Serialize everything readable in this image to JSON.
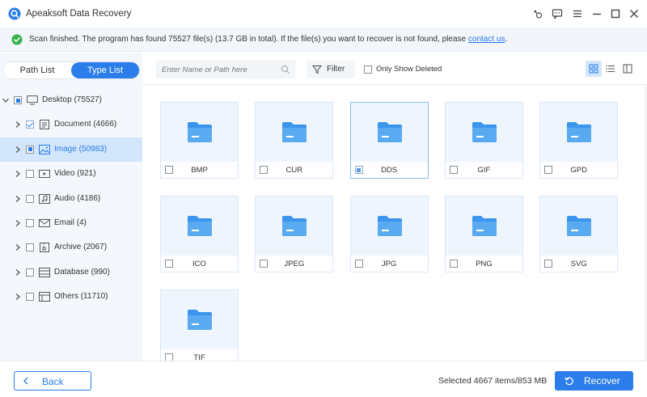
{
  "app": {
    "title": "Apeaksoft Data Recovery"
  },
  "titlebar_icons": [
    "key-icon",
    "feedback-icon",
    "menu-icon",
    "minimize-icon",
    "maximize-icon",
    "close-icon"
  ],
  "notice": {
    "message": "Scan finished. The program has found 75527 file(s) (13.7 GB in total). If the file(s) you want to recover is not found, please ",
    "link": "contact us",
    "suffix": "."
  },
  "tabs": {
    "path_list": "Path List",
    "type_list": "Type List",
    "active": "Type List"
  },
  "tree": {
    "root": {
      "label": "Desktop (75527)",
      "icon": "monitor-icon",
      "state": "partial"
    },
    "items": [
      {
        "label": "Document (4666)",
        "icon": "document-icon",
        "state": "checked"
      },
      {
        "label": "Image (50983)",
        "icon": "image-icon",
        "state": "partial",
        "active": true
      },
      {
        "label": "Video (921)",
        "icon": "video-icon",
        "state": "unchecked"
      },
      {
        "label": "Audio (4186)",
        "icon": "audio-icon",
        "state": "unchecked"
      },
      {
        "label": "Email (4)",
        "icon": "email-icon",
        "state": "unchecked"
      },
      {
        "label": "Archive (2067)",
        "icon": "archive-icon",
        "state": "unchecked"
      },
      {
        "label": "Database (990)",
        "icon": "database-icon",
        "state": "unchecked"
      },
      {
        "label": "Others (11710)",
        "icon": "others-icon",
        "state": "unchecked"
      }
    ]
  },
  "toolbar": {
    "search_placeholder": "Enter Name or Path here",
    "filter_label": "Filter",
    "only_show_deleted": "Only Show Deleted"
  },
  "folders": [
    {
      "name": "BMP",
      "state": "unchecked"
    },
    {
      "name": "CUR",
      "state": "unchecked"
    },
    {
      "name": "DDS",
      "state": "partial"
    },
    {
      "name": "GIF",
      "state": "unchecked"
    },
    {
      "name": "GPD",
      "state": "unchecked"
    },
    {
      "name": "ICO",
      "state": "unchecked"
    },
    {
      "name": "JPEG",
      "state": "unchecked"
    },
    {
      "name": "JPG",
      "state": "unchecked"
    },
    {
      "name": "PNG",
      "state": "unchecked"
    },
    {
      "name": "SVG",
      "state": "unchecked"
    },
    {
      "name": "TIF",
      "state": "unchecked"
    }
  ],
  "footer": {
    "back_label": "Back",
    "selected_info": "Selected 4667 items/853 MB",
    "recover_label": "Recover"
  },
  "colors": {
    "accent": "#2b7de9",
    "folder": "#3b95ec",
    "card_bg": "#eef5fd",
    "active_row": "#d3e6fb",
    "success": "#35b24a"
  }
}
